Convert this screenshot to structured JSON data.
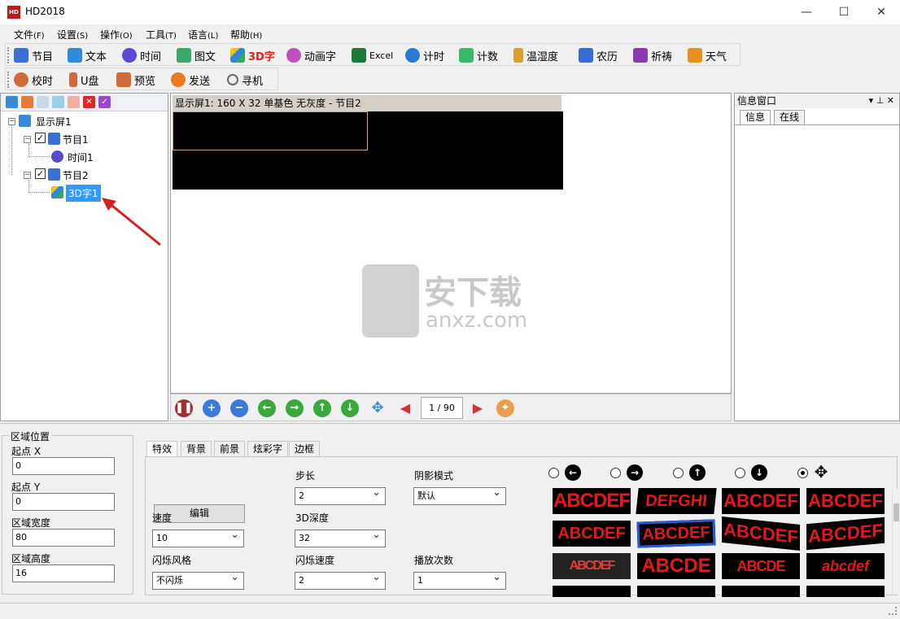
{
  "window": {
    "title": "HD2018",
    "minimize": "—",
    "maximize": "☐",
    "close": "✕"
  },
  "menu": [
    {
      "label": "文件",
      "key": "(F)"
    },
    {
      "label": "设置",
      "key": "(S)"
    },
    {
      "label": "操作",
      "key": "(O)"
    },
    {
      "label": "工具",
      "key": "(T)"
    },
    {
      "label": "语言",
      "key": "(L)"
    },
    {
      "label": "帮助",
      "key": "(H)"
    }
  ],
  "toolbar1": [
    {
      "label": "节目",
      "icon": "program-icon",
      "color": "#3a6fd8"
    },
    {
      "label": "文本",
      "icon": "text-icon",
      "color": "#2f8ad8"
    },
    {
      "label": "时间",
      "icon": "clock-icon",
      "color": "#5a4ad0"
    },
    {
      "label": "图文",
      "icon": "image-text-icon",
      "color": "#3aa86a"
    },
    {
      "label": "3D字",
      "icon": "cube-3d-icon",
      "color": "#e81a1a"
    },
    {
      "label": "动画字",
      "icon": "flower-animation-icon",
      "color": "#c050c0"
    },
    {
      "label": "Excel",
      "icon": "excel-icon",
      "color": "#1e7a3a"
    },
    {
      "label": "计时",
      "icon": "timer-icon",
      "color": "#2a7ad0"
    },
    {
      "label": "计数",
      "icon": "counter-icon",
      "color": "#3ab86a"
    },
    {
      "label": "温湿度",
      "icon": "thermometer-icon",
      "color": "#d8a030"
    },
    {
      "label": "农历",
      "icon": "calendar-icon",
      "color": "#3a6ad8"
    },
    {
      "label": "祈祷",
      "icon": "prayer-icon",
      "color": "#8a3ab0"
    },
    {
      "label": "天气",
      "icon": "weather-icon",
      "color": "#e89020"
    }
  ],
  "toolbar2": [
    {
      "label": "校时",
      "icon": "clock-sync-icon",
      "color": "#d06a3a"
    },
    {
      "label": "U盘",
      "icon": "usb-drive-icon",
      "color": "#d06a3a"
    },
    {
      "label": "预览",
      "icon": "camera-preview-icon",
      "color": "#d06a3a"
    },
    {
      "label": "发送",
      "icon": "send-icon",
      "color": "#e87a20"
    },
    {
      "label": "寻机",
      "icon": "magnifier-icon",
      "color": "#6a6a6a"
    }
  ],
  "tree": {
    "screen": "显示屏1",
    "program1": "节目1",
    "time1": "时间1",
    "program2": "节目2",
    "text3d1": "3D字1"
  },
  "preview": {
    "header": "显示屏1: 160 X 32  单基色 无灰度 - 节目2",
    "page": "1 / 90",
    "watermark_text": "安下载",
    "watermark_sub": "anxz.com"
  },
  "info": {
    "title": "信息窗口",
    "tabs": [
      "信息",
      "在线"
    ],
    "pin": "▾ ⊥ ✕"
  },
  "region": {
    "title": "区域位置",
    "x_label": "起点 X",
    "x_value": "0",
    "y_label": "起点 Y",
    "y_value": "0",
    "w_label": "区域宽度",
    "w_value": "80",
    "h_label": "区域高度",
    "h_value": "16"
  },
  "prop_tabs": [
    "特效",
    "背景",
    "前景",
    "炫彩字",
    "边框"
  ],
  "props": {
    "edit": "编辑",
    "step_label": "步长",
    "step_value": "2",
    "shadow_label": "阴影模式",
    "shadow_value": "默认",
    "speed_label": "速度",
    "speed_value": "10",
    "depth_label": "3D深度",
    "depth_value": "32",
    "flash_style_label": "闪烁风格",
    "flash_style_value": "不闪烁",
    "flash_speed_label": "闪烁速度",
    "flash_speed_value": "2",
    "play_count_label": "播放次数",
    "play_count_value": "1"
  },
  "directions": [
    {
      "arrow": "←",
      "icon": "arrow-left-icon"
    },
    {
      "arrow": "→",
      "icon": "arrow-right-icon"
    },
    {
      "arrow": "↑",
      "icon": "arrow-up-icon"
    },
    {
      "arrow": "↓",
      "icon": "arrow-down-icon"
    },
    {
      "arrow": "✥",
      "icon": "arrow-all-icon"
    }
  ],
  "thumbs": [
    "ABCDEF",
    "DEFGHI",
    "ABCDEF",
    "ABCDEF",
    "ABCDEF",
    "ABCDEF",
    "ABCDEF",
    "ABCDEF",
    "ABCDEF",
    "ABCDE",
    "ABCDE",
    "abcdef"
  ]
}
